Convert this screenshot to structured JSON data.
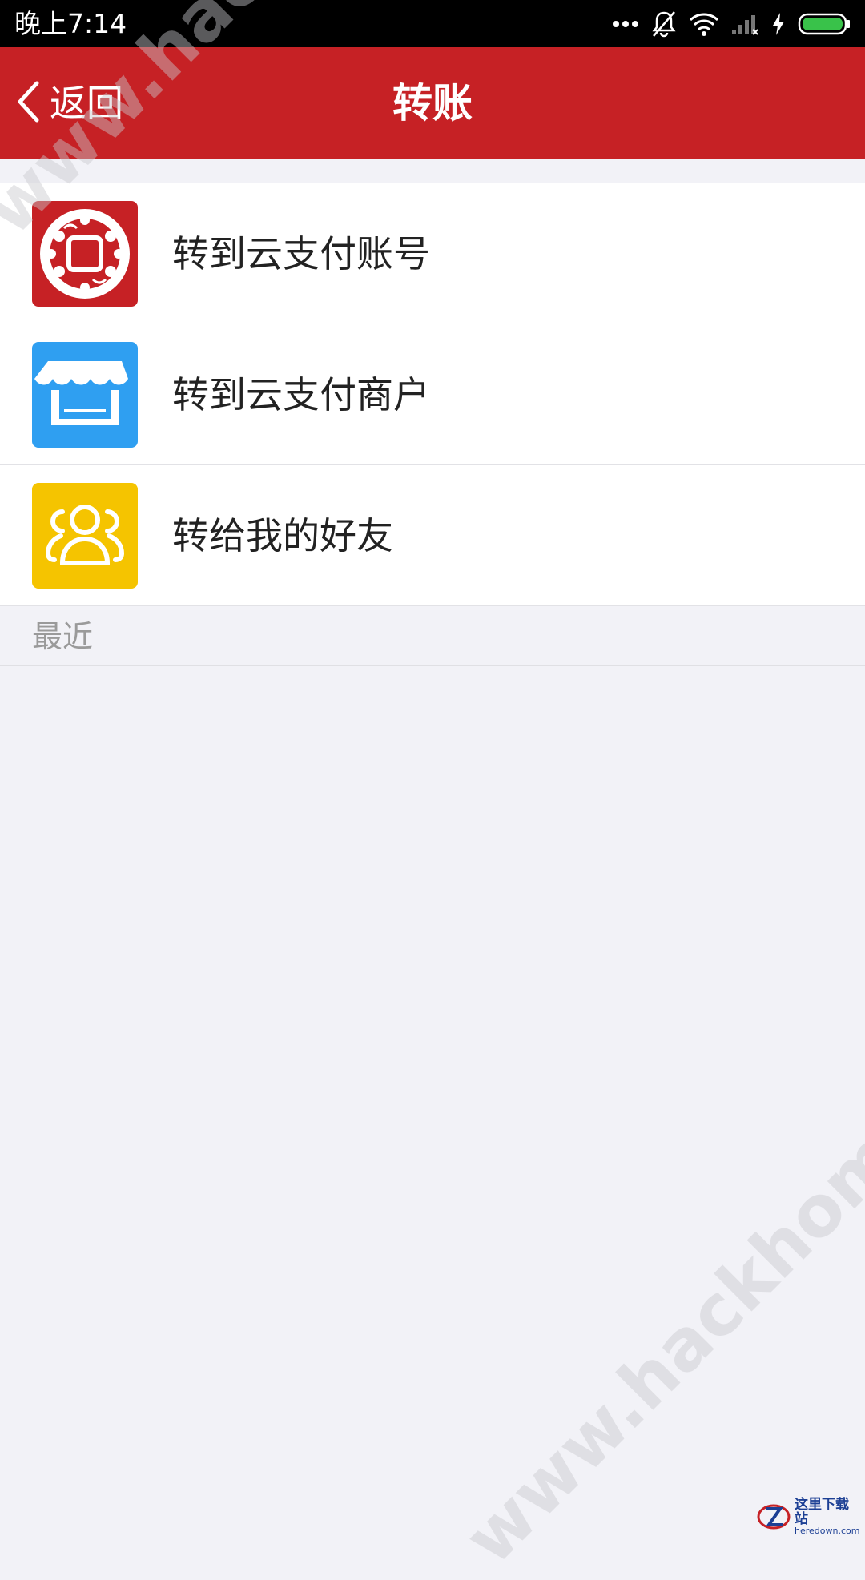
{
  "status_bar": {
    "time": "晚上7:14",
    "icons": [
      "more-dots-icon",
      "bell-muted-icon",
      "wifi-icon",
      "signal-icon",
      "charging-icon",
      "battery-icon"
    ],
    "battery_color": "#39c24a"
  },
  "nav": {
    "back_label": "返回",
    "title": "转账",
    "bar_color": "#c62125"
  },
  "menu": {
    "items": [
      {
        "label": "转到云支付账号",
        "icon": "cloud-pay-account-icon",
        "color": "#c62125"
      },
      {
        "label": "转到云支付商户",
        "icon": "storefront-icon",
        "color": "#2f9ff1"
      },
      {
        "label": "转给我的好友",
        "icon": "friends-icon",
        "color": "#f5c400"
      }
    ]
  },
  "recent": {
    "header": "最近"
  },
  "watermark": {
    "text": "www.hackhome.com"
  },
  "corner_logo": {
    "text": "这里下载站",
    "sub": "heredown.com"
  }
}
